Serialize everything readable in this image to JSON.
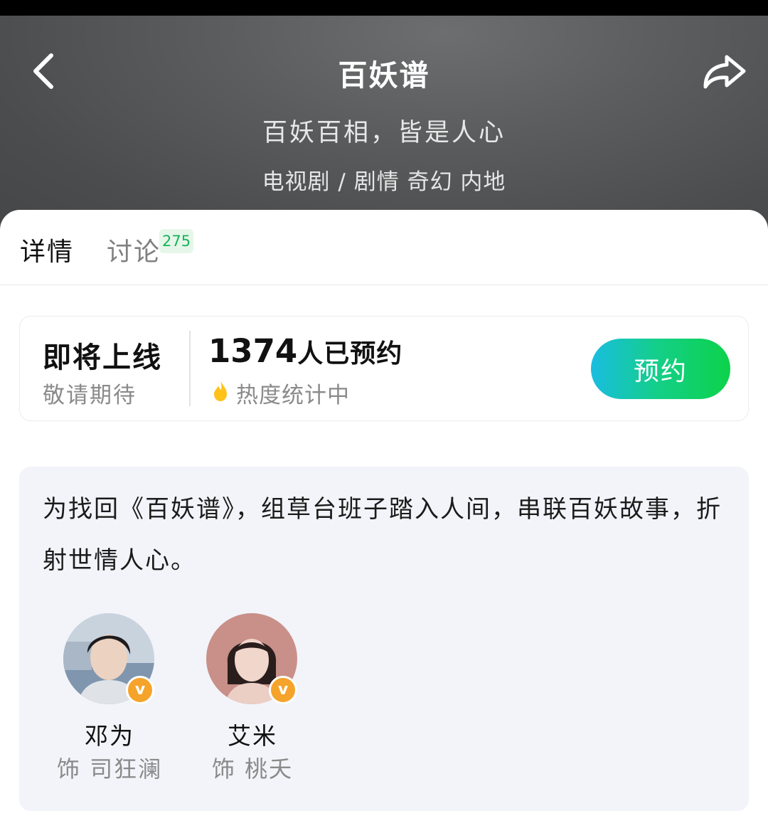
{
  "header": {
    "title": "百妖谱",
    "tagline": "百妖百相，皆是人心",
    "genre_line": "电视剧 / 剧情 奇幻 内地",
    "back_icon": "chevron-left-icon",
    "share_icon": "share-arrow-icon"
  },
  "tabs": [
    {
      "label": "详情",
      "active": true
    },
    {
      "label": "讨论",
      "badge": "275",
      "active": false
    }
  ],
  "reservation": {
    "status_title": "即将上线",
    "status_sub": "敬请期待",
    "count": "1374",
    "count_suffix": "人已预约",
    "heat_text": "热度统计中",
    "heat_icon": "flame-icon",
    "button_label": "预约"
  },
  "synopsis": {
    "text": "为找回《百妖谱》，组草台班子踏入人间，串联百妖故事，折射世情人心。"
  },
  "cast": [
    {
      "name": "邓为",
      "role": "饰 司狂澜",
      "verified": true
    },
    {
      "name": "艾米",
      "role": "饰 桃夭",
      "verified": true
    }
  ],
  "colors": {
    "hero_background": "#555758",
    "accent_green": "#0cd24a",
    "accent_cyan": "#19bde0",
    "badge_green": "#19b45a",
    "verified_orange": "#f5a32a",
    "card_background": "#f2f4f9"
  }
}
